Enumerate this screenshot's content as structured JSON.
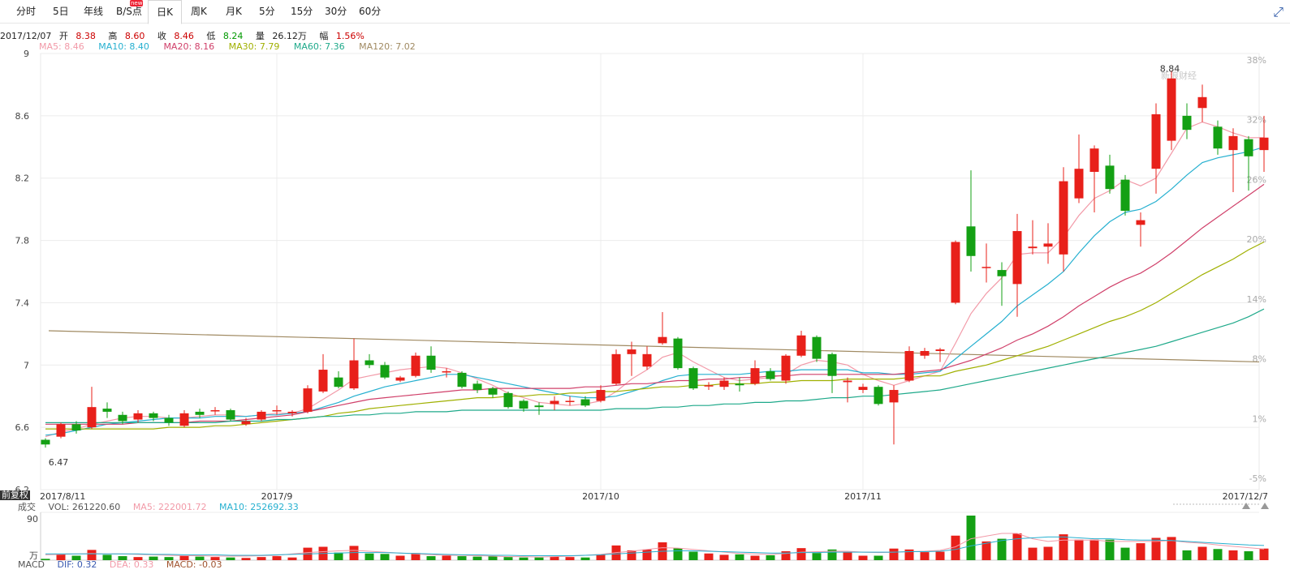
{
  "tabs": [
    "分时",
    "5日",
    "年线",
    "B/S点",
    "日K",
    "周K",
    "月K",
    "5分",
    "15分",
    "30分",
    "60分"
  ],
  "active_tab": "日K",
  "badge": "new",
  "info": {
    "date": "2017/12/07",
    "open_label": "开",
    "open": "8.38",
    "high_label": "高",
    "high": "8.60",
    "close_label": "收",
    "close": "8.46",
    "low_label": "低",
    "low": "8.24",
    "vol_label": "量",
    "vol": "26.12万",
    "chg_label": "幅",
    "chg": "1.56%"
  },
  "ma_legend": [
    {
      "text": "MA5: 8.46",
      "color": "#f29aa8"
    },
    {
      "text": "MA10: 8.40",
      "color": "#26b0d0"
    },
    {
      "text": "MA20: 8.16",
      "color": "#d0406a"
    },
    {
      "text": "MA30: 7.79",
      "color": "#a0b000"
    },
    {
      "text": "MA60: 7.36",
      "color": "#1ea98a"
    },
    {
      "text": "MA120: 7.02",
      "color": "#a08a62"
    }
  ],
  "fuquan": "前复权",
  "watermark": "新浪财经",
  "vol_legend": [
    {
      "text": "成交",
      "color": "#555"
    },
    {
      "text": "VOL: 261220.60",
      "color": "#555"
    },
    {
      "text": "MA5: 222001.72",
      "color": "#f29aa8"
    },
    {
      "text": "MA10: 252692.33",
      "color": "#26b0d0"
    }
  ],
  "macd_legend": [
    {
      "text": "MACD",
      "color": "#555"
    },
    {
      "text": "DIF: 0.32",
      "color": "#3a5ab0"
    },
    {
      "text": "DEA: 0.33",
      "color": "#f29aa8"
    },
    {
      "text": "MACD: -0.03",
      "color": "#a0522d"
    }
  ],
  "colors": {
    "up": "#e8201a",
    "down": "#14a014",
    "grid": "#ececec",
    "axis": "#333"
  },
  "chart_data": {
    "type": "candlestick",
    "y_ticks": [
      6.2,
      6.6,
      7.0,
      7.4,
      7.8,
      8.2,
      8.6,
      9.0
    ],
    "y_tick_labels": [
      "6.2",
      "6.6",
      "7",
      "7.4",
      "7.8",
      "8.2",
      "8.6",
      "9"
    ],
    "ylim": [
      6.2,
      9.0
    ],
    "pct_ticks": [
      "38%",
      "32%",
      "26%",
      "20%",
      "14%",
      "8%",
      "1%",
      "-5%"
    ],
    "x_labels": [
      {
        "text": "2017/8/11",
        "index": 0
      },
      {
        "text": "2017/9",
        "index": 15
      },
      {
        "text": "2017/10",
        "index": 36
      },
      {
        "text": "2017/11",
        "index": 53
      },
      {
        "text": "2017/12/7",
        "index": 79
      }
    ],
    "annotations": [
      {
        "text": "6.47",
        "index": 0,
        "value": 6.47
      },
      {
        "text": "8.84",
        "index": 73,
        "value": 8.84
      }
    ],
    "candles": [
      [
        6.52,
        6.49,
        6.53,
        6.47
      ],
      [
        6.54,
        6.62,
        6.63,
        6.53
      ],
      [
        6.62,
        6.58,
        6.64,
        6.56
      ],
      [
        6.6,
        6.73,
        6.86,
        6.59
      ],
      [
        6.72,
        6.7,
        6.76,
        6.66
      ],
      [
        6.68,
        6.64,
        6.7,
        6.62
      ],
      [
        6.65,
        6.69,
        6.71,
        6.63
      ],
      [
        6.69,
        6.66,
        6.7,
        6.64
      ],
      [
        6.66,
        6.63,
        6.68,
        6.61
      ],
      [
        6.61,
        6.69,
        6.71,
        6.6
      ],
      [
        6.7,
        6.68,
        6.72,
        6.66
      ],
      [
        6.71,
        6.71,
        6.73,
        6.68
      ],
      [
        6.71,
        6.65,
        6.72,
        6.64
      ],
      [
        6.62,
        6.64,
        6.66,
        6.61
      ],
      [
        6.65,
        6.7,
        6.71,
        6.64
      ],
      [
        6.71,
        6.71,
        6.74,
        6.68
      ],
      [
        6.69,
        6.7,
        6.71,
        6.67
      ],
      [
        6.7,
        6.85,
        6.87,
        6.69
      ],
      [
        6.83,
        6.97,
        7.07,
        6.82
      ],
      [
        6.92,
        6.86,
        6.96,
        6.85
      ],
      [
        6.85,
        7.03,
        7.17,
        6.84
      ],
      [
        7.03,
        7.0,
        7.07,
        6.98
      ],
      [
        7.0,
        6.92,
        7.02,
        6.91
      ],
      [
        6.9,
        6.92,
        6.93,
        6.89
      ],
      [
        6.93,
        7.06,
        7.08,
        6.92
      ],
      [
        7.06,
        6.97,
        7.12,
        6.95
      ],
      [
        6.96,
        6.96,
        6.98,
        6.92
      ],
      [
        6.95,
        6.86,
        6.96,
        6.85
      ],
      [
        6.88,
        6.84,
        6.9,
        6.82
      ],
      [
        6.85,
        6.81,
        6.86,
        6.79
      ],
      [
        6.82,
        6.73,
        6.83,
        6.72
      ],
      [
        6.77,
        6.72,
        6.78,
        6.7
      ],
      [
        6.74,
        6.73,
        6.76,
        6.68
      ],
      [
        6.75,
        6.77,
        6.8,
        6.71
      ],
      [
        6.77,
        6.77,
        6.8,
        6.74
      ],
      [
        6.78,
        6.74,
        6.8,
        6.73
      ],
      [
        6.77,
        6.84,
        6.87,
        6.76
      ],
      [
        6.88,
        7.07,
        7.1,
        6.87
      ],
      [
        7.07,
        7.1,
        7.15,
        6.93
      ],
      [
        6.99,
        7.07,
        7.12,
        6.97
      ],
      [
        7.14,
        7.18,
        7.34,
        7.13
      ],
      [
        7.17,
        6.98,
        7.18,
        6.97
      ],
      [
        6.98,
        6.85,
        6.99,
        6.84
      ],
      [
        6.87,
        6.87,
        6.89,
        6.84
      ],
      [
        6.86,
        6.9,
        6.92,
        6.84
      ],
      [
        6.88,
        6.87,
        6.92,
        6.83
      ],
      [
        6.88,
        6.98,
        7.03,
        6.87
      ],
      [
        6.96,
        6.91,
        6.98,
        6.9
      ],
      [
        6.9,
        7.06,
        7.07,
        6.88
      ],
      [
        7.06,
        7.19,
        7.22,
        7.05
      ],
      [
        7.18,
        7.04,
        7.19,
        7.02
      ],
      [
        7.07,
        6.93,
        7.08,
        6.82
      ],
      [
        6.89,
        6.9,
        6.92,
        6.76
      ],
      [
        6.84,
        6.86,
        6.88,
        6.82
      ],
      [
        6.86,
        6.75,
        6.87,
        6.74
      ],
      [
        6.76,
        6.84,
        6.87,
        6.49
      ],
      [
        6.9,
        7.09,
        7.12,
        6.89
      ],
      [
        7.06,
        7.09,
        7.11,
        7.04
      ],
      [
        7.09,
        7.1,
        7.11,
        7.02
      ],
      [
        7.4,
        7.79,
        7.8,
        7.39
      ],
      [
        7.89,
        7.7,
        8.25,
        7.6
      ],
      [
        7.63,
        7.63,
        7.78,
        7.53
      ],
      [
        7.61,
        7.57,
        7.66,
        7.38
      ],
      [
        7.52,
        7.86,
        7.97,
        7.31
      ],
      [
        7.75,
        7.76,
        7.93,
        7.71
      ],
      [
        7.76,
        7.78,
        7.91,
        7.65
      ],
      [
        7.71,
        8.18,
        8.27,
        7.6
      ],
      [
        8.07,
        8.26,
        8.48,
        8.04
      ],
      [
        8.24,
        8.39,
        8.41,
        7.98
      ],
      [
        8.28,
        8.13,
        8.35,
        8.1
      ],
      [
        8.19,
        7.99,
        8.22,
        7.96
      ],
      [
        7.9,
        7.93,
        7.98,
        7.76
      ],
      [
        8.26,
        8.61,
        8.68,
        8.1
      ],
      [
        8.44,
        8.84,
        8.89,
        8.38
      ],
      [
        8.6,
        8.51,
        8.68,
        8.45
      ],
      [
        8.65,
        8.72,
        8.8,
        8.56
      ],
      [
        8.53,
        8.39,
        8.57,
        8.35
      ],
      [
        8.38,
        8.47,
        8.52,
        8.11
      ],
      [
        8.45,
        8.34,
        8.47,
        8.12
      ],
      [
        8.38,
        8.46,
        8.6,
        8.24
      ]
    ],
    "ma_values": {
      "MA5": [
        6.54,
        6.57,
        6.59,
        6.62,
        6.64,
        6.66,
        6.67,
        6.67,
        6.66,
        6.66,
        6.67,
        6.68,
        6.68,
        6.67,
        6.68,
        6.69,
        6.69,
        6.72,
        6.78,
        6.84,
        6.91,
        6.93,
        6.95,
        6.97,
        6.98,
        6.99,
        6.98,
        6.95,
        6.91,
        6.87,
        6.82,
        6.79,
        6.76,
        6.75,
        6.74,
        6.75,
        6.77,
        6.83,
        6.91,
        6.97,
        7.05,
        7.08,
        7.02,
        6.97,
        6.92,
        6.9,
        6.91,
        6.92,
        6.94,
        7.0,
        7.03,
        7.02,
        7.0,
        6.94,
        6.9,
        6.87,
        6.9,
        6.93,
        6.96,
        7.14,
        7.33,
        7.46,
        7.56,
        7.71,
        7.72,
        7.72,
        7.82,
        7.96,
        8.07,
        8.12,
        8.19,
        8.15,
        8.2,
        8.36,
        8.52,
        8.56,
        8.53,
        8.49,
        8.46,
        8.46
      ],
      "MA10": [
        6.55,
        6.56,
        6.58,
        6.6,
        6.62,
        6.63,
        6.64,
        6.65,
        6.66,
        6.66,
        6.66,
        6.67,
        6.67,
        6.67,
        6.68,
        6.68,
        6.69,
        6.7,
        6.73,
        6.76,
        6.8,
        6.83,
        6.86,
        6.88,
        6.9,
        6.92,
        6.94,
        6.94,
        6.92,
        6.9,
        6.88,
        6.86,
        6.84,
        6.82,
        6.8,
        6.79,
        6.79,
        6.8,
        6.83,
        6.86,
        6.9,
        6.93,
        6.94,
        6.94,
        6.94,
        6.94,
        6.95,
        6.96,
        6.96,
        6.97,
        6.97,
        6.97,
        6.97,
        6.95,
        6.95,
        6.94,
        6.94,
        6.95,
        6.96,
        7.04,
        7.12,
        7.2,
        7.28,
        7.38,
        7.45,
        7.52,
        7.6,
        7.72,
        7.83,
        7.92,
        7.98,
        8.0,
        8.05,
        8.13,
        8.22,
        8.3,
        8.33,
        8.35,
        8.37,
        8.4
      ],
      "MA20": [
        6.62,
        6.62,
        6.62,
        6.62,
        6.62,
        6.62,
        6.63,
        6.63,
        6.63,
        6.63,
        6.64,
        6.64,
        6.64,
        6.65,
        6.66,
        6.67,
        6.68,
        6.7,
        6.72,
        6.74,
        6.76,
        6.78,
        6.79,
        6.8,
        6.81,
        6.82,
        6.83,
        6.84,
        6.84,
        6.85,
        6.85,
        6.85,
        6.85,
        6.85,
        6.85,
        6.86,
        6.86,
        6.87,
        6.88,
        6.88,
        6.89,
        6.9,
        6.9,
        6.91,
        6.91,
        6.92,
        6.92,
        6.93,
        6.93,
        6.94,
        6.94,
        6.94,
        6.94,
        6.94,
        6.94,
        6.94,
        6.95,
        6.96,
        6.97,
        7.0,
        7.03,
        7.07,
        7.11,
        7.16,
        7.2,
        7.25,
        7.31,
        7.38,
        7.44,
        7.5,
        7.55,
        7.59,
        7.65,
        7.72,
        7.8,
        7.88,
        7.95,
        8.02,
        8.09,
        8.16
      ],
      "MA30": [
        6.59,
        6.59,
        6.59,
        6.59,
        6.59,
        6.59,
        6.59,
        6.59,
        6.6,
        6.6,
        6.6,
        6.61,
        6.61,
        6.62,
        6.63,
        6.64,
        6.65,
        6.66,
        6.67,
        6.69,
        6.7,
        6.72,
        6.73,
        6.74,
        6.75,
        6.76,
        6.77,
        6.78,
        6.79,
        6.79,
        6.8,
        6.8,
        6.81,
        6.81,
        6.82,
        6.82,
        6.83,
        6.83,
        6.84,
        6.85,
        6.86,
        6.86,
        6.87,
        6.87,
        6.88,
        6.88,
        6.88,
        6.89,
        6.89,
        6.9,
        6.9,
        6.9,
        6.91,
        6.91,
        6.91,
        6.91,
        6.92,
        6.93,
        6.93,
        6.96,
        6.98,
        7.0,
        7.03,
        7.06,
        7.09,
        7.12,
        7.16,
        7.2,
        7.24,
        7.28,
        7.31,
        7.35,
        7.4,
        7.46,
        7.52,
        7.58,
        7.63,
        7.68,
        7.74,
        7.79
      ],
      "MA60": [
        6.63,
        6.63,
        6.63,
        6.63,
        6.63,
        6.63,
        6.63,
        6.63,
        6.63,
        6.63,
        6.63,
        6.63,
        6.64,
        6.64,
        6.64,
        6.65,
        6.65,
        6.66,
        6.67,
        6.67,
        6.68,
        6.68,
        6.69,
        6.69,
        6.7,
        6.7,
        6.7,
        6.71,
        6.71,
        6.71,
        6.71,
        6.71,
        6.71,
        6.71,
        6.71,
        6.71,
        6.71,
        6.72,
        6.72,
        6.72,
        6.73,
        6.73,
        6.74,
        6.74,
        6.75,
        6.75,
        6.76,
        6.76,
        6.77,
        6.77,
        6.78,
        6.79,
        6.79,
        6.8,
        6.8,
        6.81,
        6.82,
        6.83,
        6.84,
        6.86,
        6.88,
        6.9,
        6.92,
        6.94,
        6.96,
        6.98,
        7.0,
        7.02,
        7.04,
        7.06,
        7.08,
        7.1,
        7.12,
        7.15,
        7.18,
        7.21,
        7.24,
        7.27,
        7.31,
        7.36
      ]
    },
    "ma120_endpoints": [
      7.22,
      7.02
    ],
    "volume": {
      "ylabel": "万",
      "ytick": "90",
      "values": [
        3,
        14,
        10,
        23,
        12,
        9,
        7,
        8,
        7,
        10,
        8,
        7,
        6,
        5,
        7,
        9,
        6,
        28,
        30,
        17,
        32,
        15,
        14,
        10,
        16,
        9,
        10,
        9,
        8,
        9,
        7,
        6,
        6,
        8,
        7,
        6,
        13,
        33,
        22,
        24,
        40,
        27,
        19,
        15,
        12,
        13,
        10,
        11,
        20,
        27,
        16,
        24,
        18,
        10,
        10,
        26,
        24,
        18,
        19,
        55,
        100,
        42,
        48,
        60,
        28,
        30,
        58,
        46,
        46,
        46,
        28,
        38,
        50,
        52,
        22,
        30,
        25,
        22,
        20,
        26
      ],
      "ma5": [
        12,
        13,
        14,
        15,
        14,
        14,
        13,
        12,
        11,
        10,
        10,
        9,
        9,
        9,
        10,
        11,
        14,
        17,
        19,
        21,
        22,
        20,
        18,
        16,
        14,
        12,
        11,
        11,
        10,
        9,
        8,
        8,
        7,
        8,
        9,
        11,
        13,
        17,
        20,
        24,
        28,
        27,
        24,
        21,
        18,
        15,
        14,
        13,
        15,
        18,
        19,
        20,
        20,
        18,
        17,
        18,
        19,
        20,
        22,
        30,
        48,
        54,
        60,
        60,
        48,
        42,
        45,
        45,
        45,
        42,
        42,
        42,
        42,
        44,
        40,
        38,
        34,
        31,
        28,
        25
      ],
      "ma10": [
        14,
        14,
        14,
        14,
        14,
        14,
        14,
        13,
        13,
        12,
        12,
        12,
        11,
        11,
        11,
        12,
        13,
        14,
        15,
        16,
        17,
        17,
        17,
        16,
        15,
        14,
        13,
        12,
        12,
        11,
        11,
        10,
        10,
        10,
        10,
        11,
        12,
        14,
        16,
        18,
        20,
        21,
        21,
        20,
        19,
        18,
        17,
        16,
        16,
        17,
        17,
        18,
        18,
        18,
        18,
        18,
        19,
        19,
        20,
        24,
        32,
        38,
        44,
        48,
        50,
        52,
        52,
        50,
        48,
        48,
        46,
        45,
        45,
        44,
        42,
        40,
        38,
        36,
        34,
        33
      ]
    }
  }
}
